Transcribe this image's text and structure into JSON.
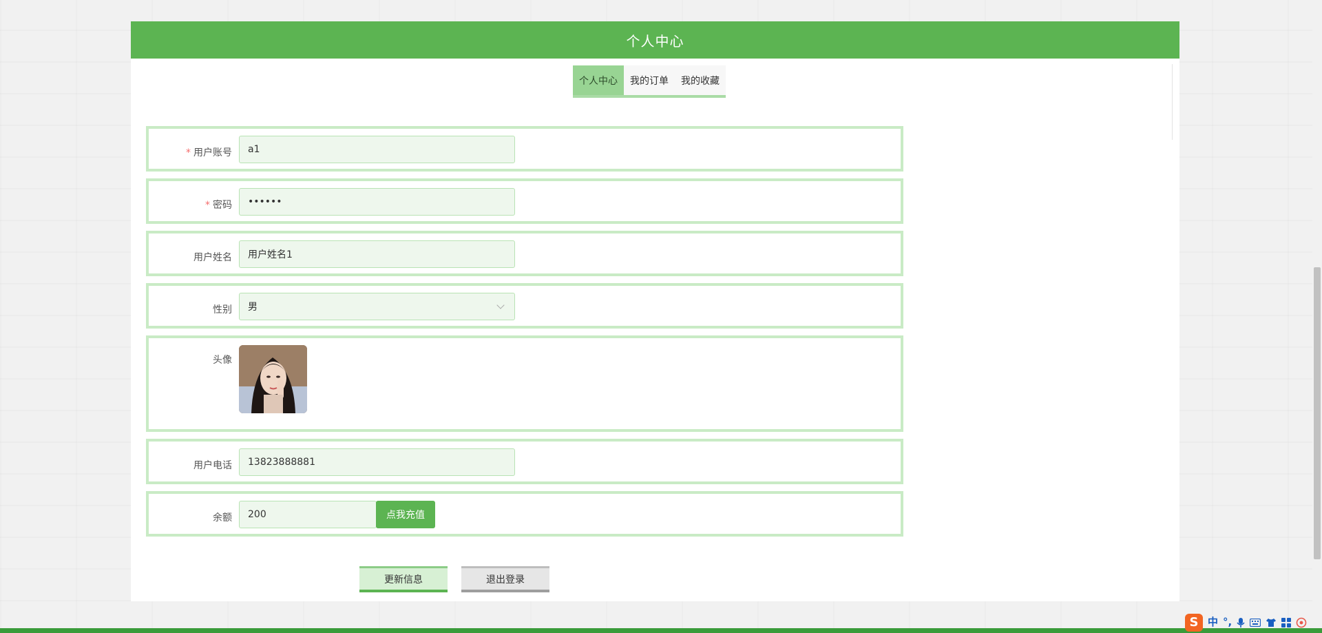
{
  "header": {
    "title": "个人中心"
  },
  "tabs": [
    {
      "label": "个人中心",
      "active": true
    },
    {
      "label": "我的订单",
      "active": false
    },
    {
      "label": "我的收藏",
      "active": false
    }
  ],
  "form": {
    "username": {
      "label": "用户账号",
      "value": "a1",
      "required": true
    },
    "password": {
      "label": "密码",
      "value": "••••••",
      "required": true
    },
    "real_name": {
      "label": "用户姓名",
      "value": "用户姓名1"
    },
    "gender": {
      "label": "性别",
      "value": "男"
    },
    "avatar": {
      "label": "头像"
    },
    "phone": {
      "label": "用户电话",
      "value": "13823888881"
    },
    "balance": {
      "label": "余额",
      "value": "200",
      "recharge_label": "点我充值"
    }
  },
  "required_mark": "*",
  "actions": {
    "update_label": "更新信息",
    "logout_label": "退出登录"
  },
  "ime": {
    "logo_text": "S",
    "mode": "中",
    "icons": [
      "punctuation-icon",
      "microphone-icon",
      "keyboard-icon",
      "skin-icon",
      "toolbox-icon",
      "settings-icon"
    ]
  },
  "colors": {
    "primary_green": "#5cb452",
    "tab_active": "#98d493",
    "row_border": "#c9ebc5",
    "input_bg": "#eef7ed",
    "required": "#f56c6c"
  }
}
